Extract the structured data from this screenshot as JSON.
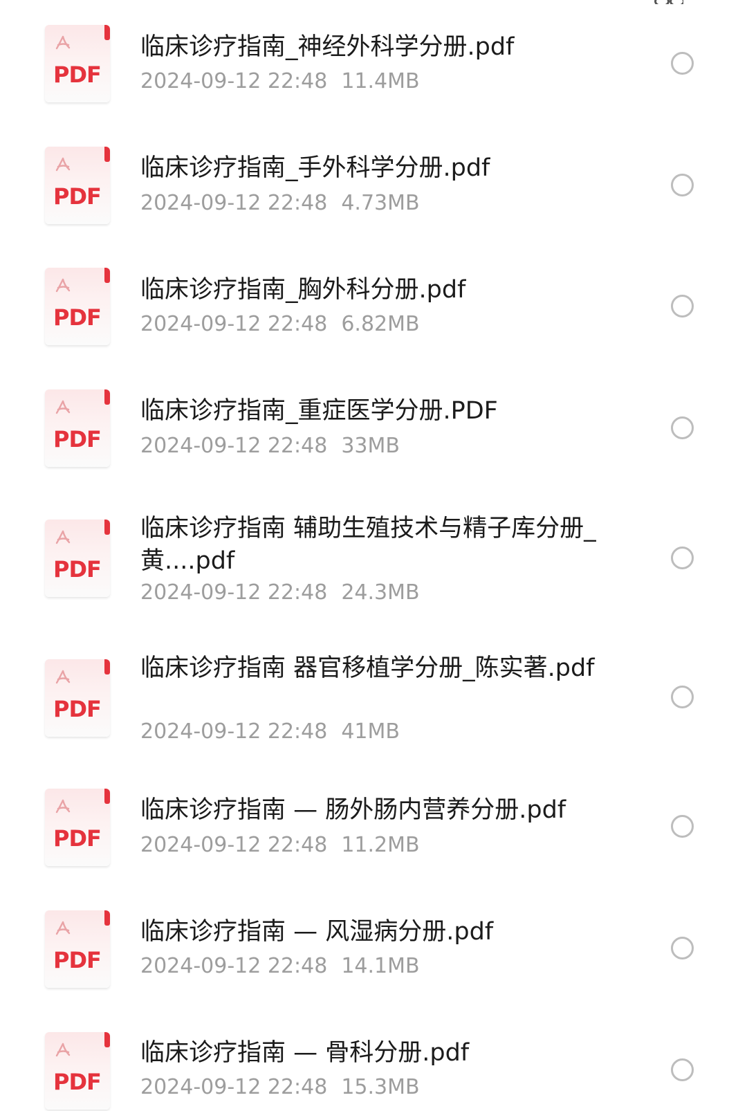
{
  "files": [
    {
      "name": "临床诊疗指南_神经外科学分册.pdf",
      "date": "2024-09-12 22:48",
      "size": "11.4MB",
      "icon": "pdf-file-icon",
      "icon_label": "PDF",
      "selected": false
    },
    {
      "name": "临床诊疗指南_手外科学分册.pdf",
      "date": "2024-09-12 22:48",
      "size": "4.73MB",
      "icon": "pdf-file-icon",
      "icon_label": "PDF",
      "selected": false
    },
    {
      "name": "临床诊疗指南_胸外科分册.pdf",
      "date": "2024-09-12 22:48",
      "size": "6.82MB",
      "icon": "pdf-file-icon",
      "icon_label": "PDF",
      "selected": false
    },
    {
      "name": "临床诊疗指南_重症医学分册.PDF",
      "date": "2024-09-12 22:48",
      "size": "33MB",
      "icon": "pdf-file-icon",
      "icon_label": "PDF",
      "selected": false
    },
    {
      "name": "临床诊疗指南 辅助生殖技术与精子库分册_黄....pdf",
      "date": "2024-09-12 22:48",
      "size": "24.3MB",
      "icon": "pdf-file-icon",
      "icon_label": "PDF",
      "selected": false
    },
    {
      "name": "临床诊疗指南 器官移植学分册_陈实著.pdf",
      "date": "2024-09-12 22:48",
      "size": "41MB",
      "icon": "pdf-file-icon",
      "icon_label": "PDF",
      "selected": false
    },
    {
      "name": "临床诊疗指南 — 肠外肠内营养分册.pdf",
      "date": "2024-09-12 22:48",
      "size": "11.2MB",
      "icon": "pdf-file-icon",
      "icon_label": "PDF",
      "selected": false
    },
    {
      "name": "临床诊疗指南 — 风湿病分册.pdf",
      "date": "2024-09-12 22:48",
      "size": "14.1MB",
      "icon": "pdf-file-icon",
      "icon_label": "PDF",
      "selected": false
    },
    {
      "name": "临床诊疗指南 — 骨科分册.pdf",
      "date": "2024-09-12 22:48",
      "size": "15.3MB",
      "icon": "pdf-file-icon",
      "icon_label": "PDF",
      "selected": false
    }
  ],
  "colors": {
    "pdf_red": "#e5333d",
    "name_text": "#1b1b1b",
    "meta_text": "#9d9d9d",
    "radio_border": "#bdbdbd"
  }
}
